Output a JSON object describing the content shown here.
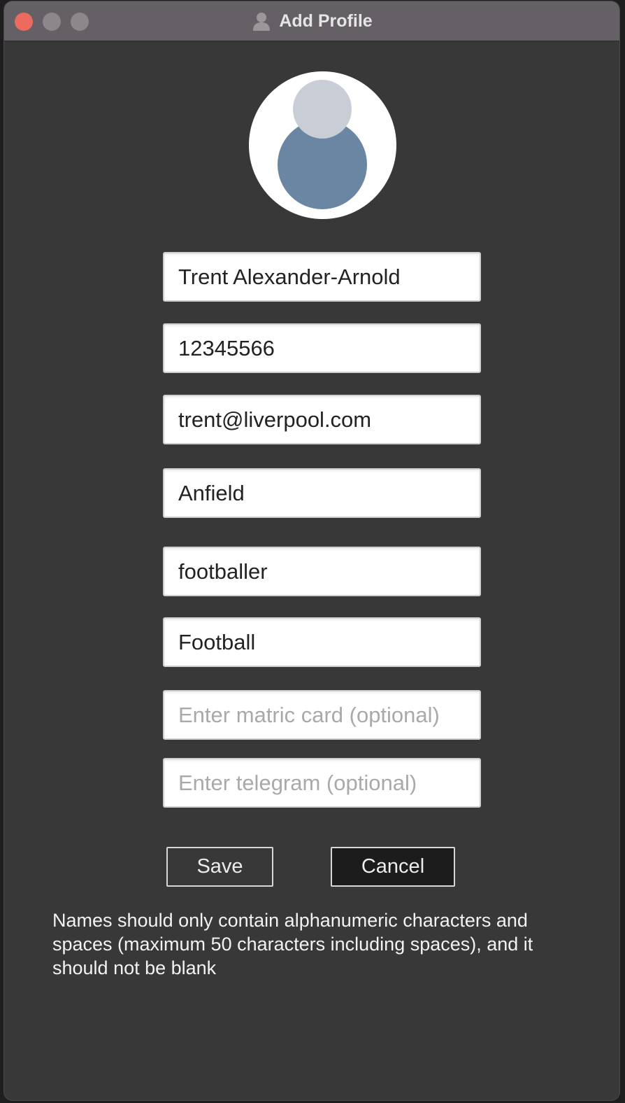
{
  "window": {
    "title": "Add Profile",
    "title_icon": "person-icon",
    "controls": [
      "close",
      "minimize",
      "maximize"
    ]
  },
  "avatar": {
    "icon": "default-avatar-icon"
  },
  "form": {
    "name": {
      "value": "Trent Alexander-Arnold"
    },
    "phone": {
      "value": "12345566"
    },
    "email": {
      "value": "trent@liverpool.com"
    },
    "address": {
      "value": "Anfield"
    },
    "role": {
      "value": "footballer"
    },
    "cca": {
      "value": "Football"
    },
    "matric": {
      "value": "",
      "placeholder": "Enter matric card (optional)"
    },
    "telegram": {
      "value": "",
      "placeholder": "Enter telegram (optional)"
    }
  },
  "buttons": {
    "save_label": "Save",
    "cancel_label": "Cancel"
  },
  "feedback": {
    "message": "Names should only contain alphanumeric characters and spaces (maximum 50 characters including spaces), and it should not be blank"
  },
  "colors": {
    "background": "#383838",
    "titlebar": "#656065",
    "close_button": "#ec6a5e",
    "avatar_head": "#c9ced6",
    "avatar_body": "#6a86a3"
  }
}
